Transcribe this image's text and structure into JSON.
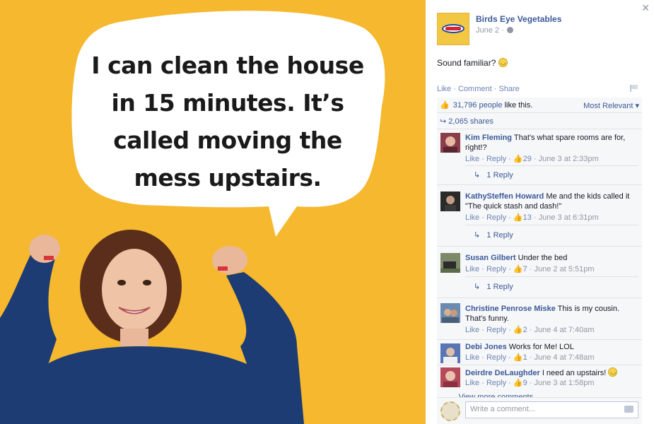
{
  "photo": {
    "bubble_text_lines": [
      "I can clean the house",
      "in 15 minutes. It’s",
      "called moving the",
      "mess upstairs."
    ]
  },
  "post": {
    "page_name": "Birds Eye Vegetables",
    "date": "June 2 ·",
    "status": "Sound familiar?",
    "actions": [
      "Like",
      "Comment",
      "Share"
    ],
    "likes_count": "31,796 people",
    "likes_suffix": "like this.",
    "most_relevant": "Most Relevant",
    "shares": "2,065 shares"
  },
  "comments": [
    {
      "name": "Kim Fleming",
      "text": "That's what spare rooms are for, right!?",
      "like": "Like",
      "reply": "Reply",
      "likes": "29",
      "time": "June 3 at 2:33pm",
      "replies": "1 Reply"
    },
    {
      "name": "KathySteffen Howard",
      "text": "Me and the kids called it \"The quick stash and dash!\"",
      "like": "Like",
      "reply": "Reply",
      "likes": "13",
      "time": "June 3 at 6:31pm",
      "replies": "1 Reply"
    },
    {
      "name": "Susan Gilbert",
      "text": "Under the bed",
      "like": "Like",
      "reply": "Reply",
      "likes": "7",
      "time": "June 2 at 5:51pm",
      "replies": "1 Reply"
    },
    {
      "name": "Christine Penrose Miske",
      "text": "This is my cousin. That's funny.",
      "like": "Like",
      "reply": "Reply",
      "likes": "2",
      "time": "June 4 at 7:40am"
    },
    {
      "name": "Debi Jones",
      "text": "Works for Me! LOL",
      "like": "Like",
      "reply": "Reply",
      "likes": "1",
      "time": "June 4 at 7:48am"
    },
    {
      "name": "Deirdre DeLaughder",
      "text": "I need an upstairs!",
      "like": "Like",
      "reply": "Reply",
      "likes": "9",
      "time": "June 3 at 1:58pm"
    }
  ],
  "view_more": "View more comments",
  "compose": {
    "placeholder": "Write a comment..."
  },
  "colors": {
    "photo_bg": "#f5b82e",
    "link": "#3b5998",
    "meta": "#6d84b4"
  }
}
